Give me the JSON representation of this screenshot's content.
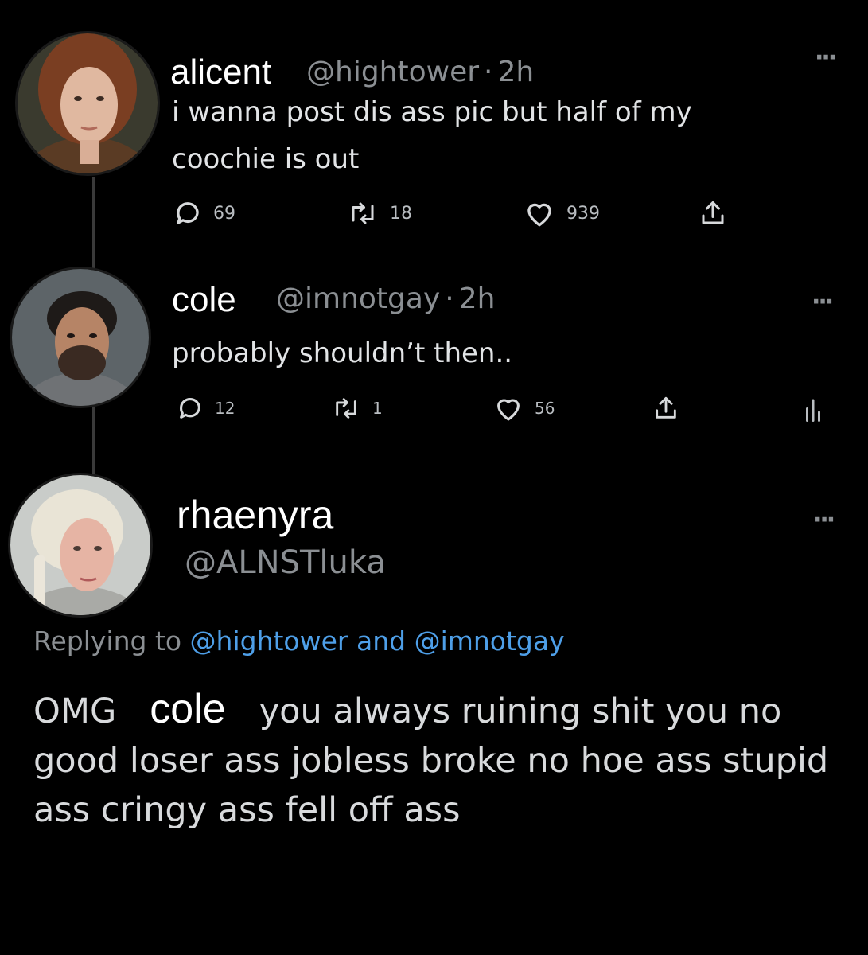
{
  "tweets": [
    {
      "name": "alicent",
      "handle": "@hightower",
      "time": "2h",
      "text": "i wanna post dis ass pic but half of my coochie is out",
      "replies": "69",
      "retweets": "18",
      "likes": "939"
    },
    {
      "name": "cole",
      "handle": "@imnotgay",
      "time": "2h",
      "text": "probably shouldn’t then..",
      "replies": "12",
      "retweets": "1",
      "likes": "56"
    }
  ],
  "reply": {
    "name": "rhaenyra",
    "handle": "@ALNSTluka",
    "replying_prefix": "Replying to",
    "replying_to_1": "@hightower",
    "replying_and": "and",
    "replying_to_2": "@imnotgay",
    "text_start": "OMG",
    "text_name": "cole",
    "text_rest": "you always ruining shit you no good loser ass jobless broke no hoe ass stupid ass cringy ass fell off ass"
  },
  "icons": {
    "more": "more-horizontal-icon",
    "reply": "comment-bubble-icon",
    "retweet": "retweet-icon",
    "like": "heart-icon",
    "share": "share-upload-icon",
    "analytics": "analytics-bars-icon"
  },
  "colors": {
    "background": "#000000",
    "link": "#4e9fe8",
    "muted": "#8b8f93"
  }
}
